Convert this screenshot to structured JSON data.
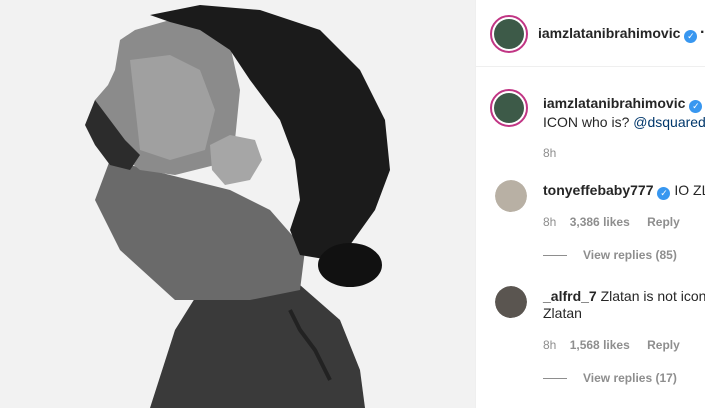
{
  "post": {
    "author": "iamzlatanibrahimovic",
    "more_label": "···",
    "caption_username": "iamzlatanibrahimovic",
    "caption_text_start": "I",
    "caption_line2": "ICON who is?",
    "caption_mention": "@dsquared",
    "caption_time": "8h"
  },
  "comments": [
    {
      "username": "tonyeffebaby777",
      "text": "IO ZL",
      "time": "8h",
      "likes": "3,386 likes",
      "reply_label": "Reply",
      "view_replies": "View replies (85)"
    },
    {
      "username": "_alfrd_7",
      "text": "Zlatan is not icon",
      "text_line2": "Zlatan",
      "time": "8h",
      "likes": "1,568 likes",
      "reply_label": "Reply",
      "view_replies": "View replies (17)"
    }
  ],
  "colors": {
    "verified": "#3897f0",
    "story_ring": "#c13584",
    "mention": "#00376b"
  }
}
